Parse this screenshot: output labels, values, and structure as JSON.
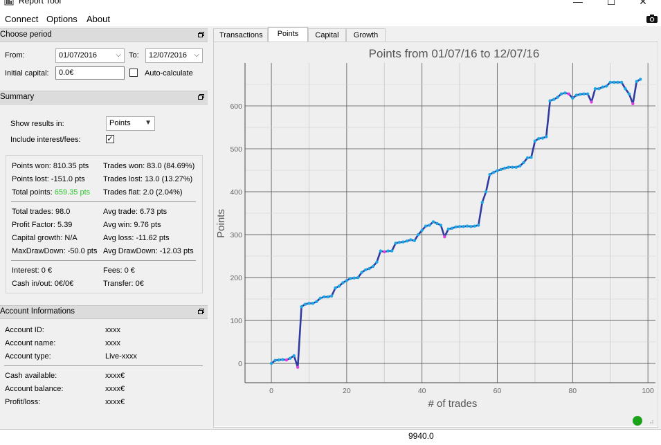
{
  "window": {
    "title": "Report Tool",
    "buttons": {
      "minimize": "—",
      "maximize": "☐",
      "close": "✕"
    }
  },
  "menu": [
    "Connect",
    "Options",
    "About"
  ],
  "period_panel": {
    "title": "Choose period",
    "from_label": "From:",
    "from_value": "01/07/2016",
    "to_label": "To:",
    "to_value": "12/07/2016",
    "initial_capital_label": "Initial capital:",
    "initial_capital_value": "0.0€",
    "auto_calculate_label": "Auto-calculate",
    "auto_calculate_checked": false
  },
  "summary_panel": {
    "title": "Summary",
    "show_results_label": "Show results in:",
    "show_results_value": "Points",
    "include_interest_label": "Include interest/fees:",
    "include_interest_checked": true,
    "points_won": "Points won: 810.35 pts",
    "points_lost": "Points lost: -151.0 pts",
    "total_points_label": "Total points:",
    "total_points_value": "659.35 pts",
    "trades_won": "Trades won: 83.0 (84.69%)",
    "trades_lost": "Trades lost: 13.0 (13.27%)",
    "trades_flat": "Trades flat: 2.0 (2.04%)",
    "total_trades": "Total trades: 98.0",
    "profit_factor": "Profit Factor: 5.39",
    "capital_growth": "Capital growth: N/A",
    "max_drawdown": "MaxDrawDown: -50.0 pts",
    "avg_trade": "Avg trade: 6.73 pts",
    "avg_win": "Avg win: 9.76 pts",
    "avg_loss": "Avg loss: -11.62 pts",
    "avg_drawdown": "Avg DrawDown: -12.03 pts",
    "interest": "Interest: 0 €",
    "cash_in_out": "Cash in/out: 0€/0€",
    "fees": "Fees: 0 €",
    "transfer": "Transfer: 0€"
  },
  "account_panel": {
    "title": "Account Informations",
    "rows": [
      {
        "label": "Account ID:",
        "value": "xxxx"
      },
      {
        "label": "Account name:",
        "value": "xxxx"
      },
      {
        "label": "Account type:",
        "value": "Live-xxxx"
      },
      {
        "label": "Cash available:",
        "value": "xxxx€"
      },
      {
        "label": "Account balance:",
        "value": "xxxx€"
      },
      {
        "label": "Profit/loss:",
        "value": "xxxx€"
      }
    ]
  },
  "tabs": [
    {
      "label": "Transactions",
      "active": false
    },
    {
      "label": "Points",
      "active": true
    },
    {
      "label": "Capital",
      "active": false
    },
    {
      "label": "Growth",
      "active": false
    }
  ],
  "status": {
    "connection_color": "#1ba21b"
  },
  "spreadsheet_cell_value": "9940.0",
  "colors": {
    "line": "#2f3b9e",
    "win_marker": "#1aa8e6",
    "loss_marker": "#e040e0",
    "total_points_text": "#31c431"
  },
  "chart_data": {
    "type": "line",
    "title": "Points from 01/07/16 to 12/07/16",
    "xlabel": "# of trades",
    "ylabel": "Points",
    "xlim": [
      -7,
      102
    ],
    "ylim": [
      -45,
      700
    ],
    "xticks": [
      0,
      20,
      40,
      60,
      80,
      100
    ],
    "yticks": [
      0,
      100,
      200,
      300,
      400,
      500,
      600
    ],
    "grid": true,
    "series": [
      {
        "x": [
          0,
          1,
          2,
          3,
          4,
          5,
          6,
          7,
          8,
          9,
          10,
          11,
          12,
          13,
          14,
          15,
          16,
          17,
          18,
          19,
          20,
          21,
          22,
          23,
          24,
          25,
          26,
          27,
          28,
          29,
          30,
          31,
          32,
          33,
          34,
          35,
          36,
          37,
          38,
          39,
          40,
          41,
          42,
          43,
          44,
          45,
          46,
          47,
          48,
          49,
          50,
          51,
          52,
          53,
          54,
          55,
          56,
          57,
          58,
          59,
          60,
          61,
          62,
          63,
          64,
          65,
          66,
          67,
          68,
          69,
          70,
          71,
          72,
          73,
          74,
          75,
          76,
          77,
          78,
          79,
          80,
          81,
          82,
          83,
          84,
          85,
          86,
          87,
          88,
          89,
          90,
          91,
          92,
          93,
          94,
          95,
          96,
          97,
          98
        ],
        "y": [
          0,
          7,
          8,
          9,
          8,
          12,
          18,
          -9,
          132,
          138,
          140,
          140,
          144,
          152,
          155,
          155,
          157,
          176,
          180,
          188,
          193,
          198,
          199,
          200,
          212,
          218,
          221,
          226,
          236,
          262,
          260,
          262,
          262,
          280,
          282,
          283,
          285,
          288,
          286,
          300,
          310,
          320,
          322,
          330,
          326,
          322,
          295,
          313,
          315,
          318,
          319,
          319,
          320,
          319,
          320,
          322,
          375,
          400,
          440,
          445,
          449,
          452,
          455,
          457,
          457,
          457,
          460,
          468,
          479,
          480,
          518,
          524,
          525,
          528,
          612,
          615,
          620,
          628,
          630,
          628,
          618,
          625,
          627,
          628,
          628,
          609,
          640,
          640,
          644,
          646,
          655,
          655,
          655,
          655,
          640,
          628,
          605,
          657,
          662
        ],
        "loss_indices": [
          4,
          7,
          30,
          46,
          79,
          85,
          96
        ]
      }
    ]
  }
}
